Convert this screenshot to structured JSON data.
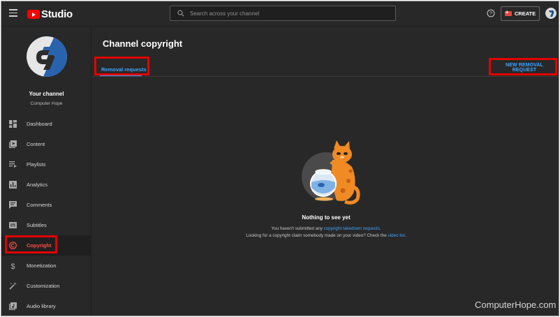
{
  "app": {
    "logo_text": "Studio"
  },
  "search": {
    "placeholder": "Search across your channel"
  },
  "header": {
    "create_label": "CREATE"
  },
  "channel": {
    "name": "Your channel",
    "subtitle": "Computer Hope"
  },
  "sidebar": {
    "items": [
      {
        "label": "Dashboard",
        "icon": "dashboard-icon"
      },
      {
        "label": "Content",
        "icon": "content-icon"
      },
      {
        "label": "Playlists",
        "icon": "playlists-icon"
      },
      {
        "label": "Analytics",
        "icon": "analytics-icon"
      },
      {
        "label": "Comments",
        "icon": "comments-icon"
      },
      {
        "label": "Subtitles",
        "icon": "subtitles-icon"
      },
      {
        "label": "Copyright",
        "icon": "copyright-icon",
        "active": true
      },
      {
        "label": "Monetization",
        "icon": "dollar-icon"
      },
      {
        "label": "Customization",
        "icon": "wand-icon"
      },
      {
        "label": "Audio library",
        "icon": "audio-library-icon"
      }
    ]
  },
  "main": {
    "title": "Channel copyright",
    "tab_label": "Removal requests",
    "new_request_label": "NEW REMOVAL REQUEST",
    "empty": {
      "title": "Nothing to see yet",
      "line1_prefix": "You haven't submitted any ",
      "line1_link": "copyright takedown requests",
      "line1_suffix": ".",
      "line2_prefix": "Looking for a copyright claim somebody made on your video? Check the ",
      "line2_link": "video list",
      "line2_suffix": "."
    }
  },
  "watermark": "ComputerHope.com",
  "colors": {
    "background": "#282828",
    "accent": "#3ea6ff",
    "highlight_box": "#e30000",
    "active_nav": "#ff4e45"
  }
}
